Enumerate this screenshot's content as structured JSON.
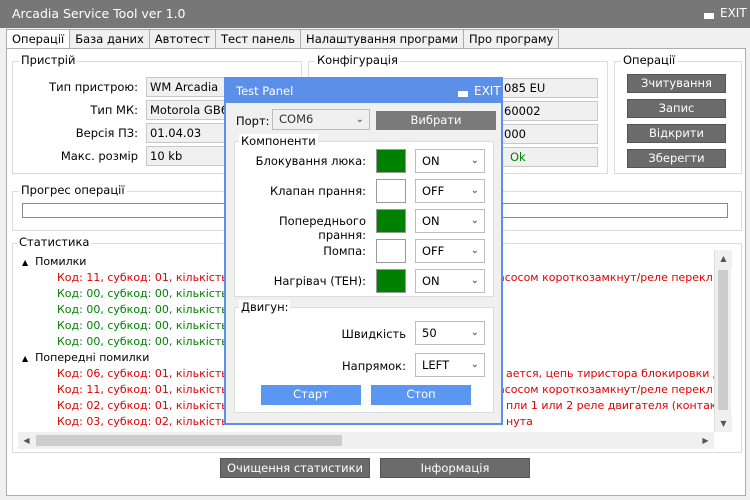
{
  "window": {
    "title": "Arcadia Service Tool ver 1.0",
    "exit_label": "EXIT"
  },
  "tabs": [
    "Операції",
    "База даних",
    "Автотест",
    "Тест панель",
    "Налаштування програми",
    "Про програму"
  ],
  "device": {
    "group_title": "Пристрій",
    "rows": [
      {
        "label": "Тип пристрою:",
        "value": "WM Arcadia"
      },
      {
        "label": "Тип МК:",
        "value": "Motorola GB6"
      },
      {
        "label": "Версія ПЗ:",
        "value": "01.04.03"
      },
      {
        "label": "Макс. розмір",
        "value": "10 kb"
      }
    ]
  },
  "config": {
    "group_title": "Конфігурація",
    "values": [
      "085 EU",
      "60002",
      "000",
      "Ok"
    ]
  },
  "operations": {
    "group_title": "Операції",
    "buttons": [
      "Зчитування",
      "Запис",
      "Відкрити",
      "Зберегти"
    ]
  },
  "progress": {
    "group_title": "Прогрес операції",
    "value": 0
  },
  "statistics": {
    "group_title": "Статистика",
    "errors_label": "Помилки",
    "errors": [
      {
        "text": "Код: 11, субкод: 01, кількість: 0",
        "tail": "асосом короткозамкнут/реле перекл",
        "color": "red"
      },
      {
        "text": "Код: 00, субкод: 00, кількість: 0",
        "tail": "",
        "color": "green"
      },
      {
        "text": "Код: 00, субкод: 00, кількість: 0",
        "tail": "",
        "color": "green"
      },
      {
        "text": "Код: 00, субкод: 00, кількість: 0",
        "tail": "",
        "color": "green"
      },
      {
        "text": "Код: 00, субкод: 00, кількість: 0",
        "tail": "",
        "color": "green"
      }
    ],
    "prev_label": "Попередні помилки",
    "prev_errors": [
      {
        "text": "Код: 06, субкод: 01, кількість: 0",
        "tail": "ается, цепь тиристора блокировки дв",
        "color": "red"
      },
      {
        "text": "Код: 11, субкод: 01, кількість: 0",
        "tail": "асосом короткозамкнут/реле перекл",
        "color": "red"
      },
      {
        "text": "Код: 02, субкод: 01, кількість: 0",
        "tail": "пли 1 или 2 реле двигателя (контакты",
        "color": "red"
      },
      {
        "text": "Код: 03, субкод: 02, кількість: 0",
        "tail": "нута",
        "color": "red"
      }
    ]
  },
  "bottom_buttons": {
    "clear": "Очищення статистики",
    "info": "Інформація"
  },
  "test_panel": {
    "title": "Test Panel",
    "exit_label": "EXIT",
    "port_label": "Порт:",
    "port_value": "COM6",
    "select_label": "Вибрати",
    "components_title": "Компоненти",
    "components": [
      {
        "label": "Блокування люка:",
        "state": "ON",
        "on": true
      },
      {
        "label": "Клапан прання:",
        "state": "OFF",
        "on": false
      },
      {
        "label": "Попереднього прання:",
        "state": "ON",
        "on": true
      },
      {
        "label": "Помпа:",
        "state": "OFF",
        "on": false
      },
      {
        "label": "Нагрівач (ТЕН):",
        "state": "ON",
        "on": true
      }
    ],
    "motor_title": "Двигун:",
    "speed_label": "Швидкість",
    "speed_value": "50",
    "direction_label": "Напрямок:",
    "direction_value": "LEFT",
    "start_label": "Старт",
    "stop_label": "Стоп"
  },
  "colors": {
    "accent": "#5b8fe8",
    "on_indicator": "#008000",
    "error": "#e00000",
    "ok": "#008000"
  }
}
